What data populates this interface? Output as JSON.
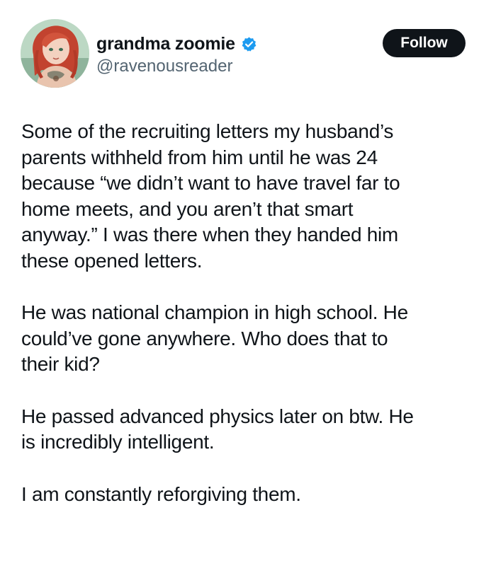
{
  "author": {
    "display_name": "grandma zoomie",
    "handle": "@ravenousreader",
    "verified_icon": "verified-badge-icon",
    "avatar_icon": "avatar"
  },
  "actions": {
    "follow_label": "Follow"
  },
  "colors": {
    "text_primary": "#0f1419",
    "text_secondary": "#536471",
    "verified_blue": "#1d9bf0",
    "follow_button_bg": "#0f1419"
  },
  "tweet": {
    "paragraphs": [
      "Some of the recruiting letters my husband’s\nparents withheld from him until he was 24\nbecause “we didn’t want to have travel far to\nhome meets, and you aren’t that smart\nanyway.” I was there when they handed him\nthese opened letters.",
      "He was national champion in high school. He\ncould’ve gone anywhere. Who does that to\ntheir kid?",
      "He passed advanced physics later on btw. He\nis incredibly intelligent.",
      "I am constantly reforgiving  them."
    ]
  }
}
